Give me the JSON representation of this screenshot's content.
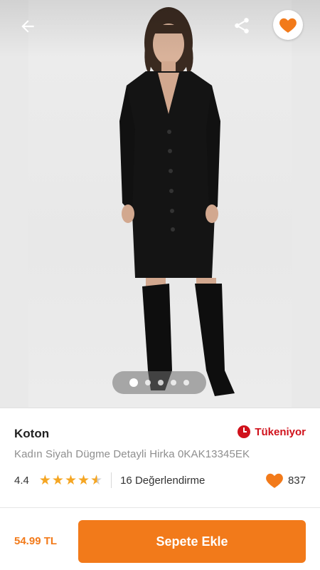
{
  "colors": {
    "accent": "#f27a1a",
    "alert": "#d0111b",
    "star": "#f5a623"
  },
  "header": {
    "back_icon": "arrow-left-icon",
    "share_icon": "share-icon",
    "favorite_icon": "heart-icon"
  },
  "gallery": {
    "page_count": 5,
    "active_index": 0
  },
  "product": {
    "brand": "Koton",
    "stock_status": "Tükeniyor",
    "name": "Kadın Siyah Dügme Detayli Hirka 0KAK13345EK",
    "rating": "4.4",
    "rating_value": 4.4,
    "reviews": "16 Değerlendirme",
    "likes": "837"
  },
  "footer": {
    "price": "54.99 TL",
    "add_to_cart_label": "Sepete Ekle"
  }
}
